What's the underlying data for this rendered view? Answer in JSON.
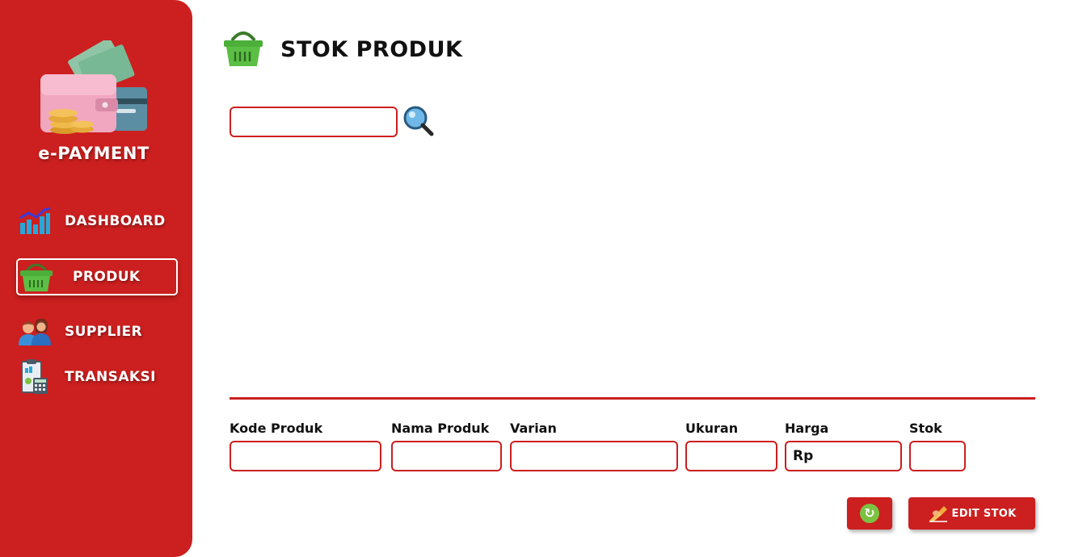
{
  "sidebar": {
    "brand": "e-PAYMENT",
    "items": [
      {
        "label": "DASHBOARD",
        "icon": "chart-icon"
      },
      {
        "label": "PRODUK",
        "icon": "basket-icon",
        "active": true
      },
      {
        "label": "SUPPLIER",
        "icon": "people-icon"
      },
      {
        "label": "TRANSAKSI",
        "icon": "calculator-icon"
      }
    ]
  },
  "header": {
    "title": "STOK PRODUK",
    "icon": "basket-icon"
  },
  "search": {
    "value": "",
    "icon": "magnifier-icon"
  },
  "form": {
    "fields": [
      {
        "label": "Kode Produk",
        "value": ""
      },
      {
        "label": "Nama Produk",
        "value": ""
      },
      {
        "label": "Varian",
        "value": ""
      },
      {
        "label": "Ukuran",
        "value": ""
      },
      {
        "label": "Harga",
        "value": "Rp"
      },
      {
        "label": "Stok",
        "value": ""
      }
    ]
  },
  "actions": {
    "refresh_icon": "refresh-icon",
    "edit_label": "EDIT STOK",
    "edit_icon": "writing-hand-icon"
  },
  "colors": {
    "primary": "#cc1f1f",
    "text": "#111111",
    "accent_green": "#7cc242"
  }
}
